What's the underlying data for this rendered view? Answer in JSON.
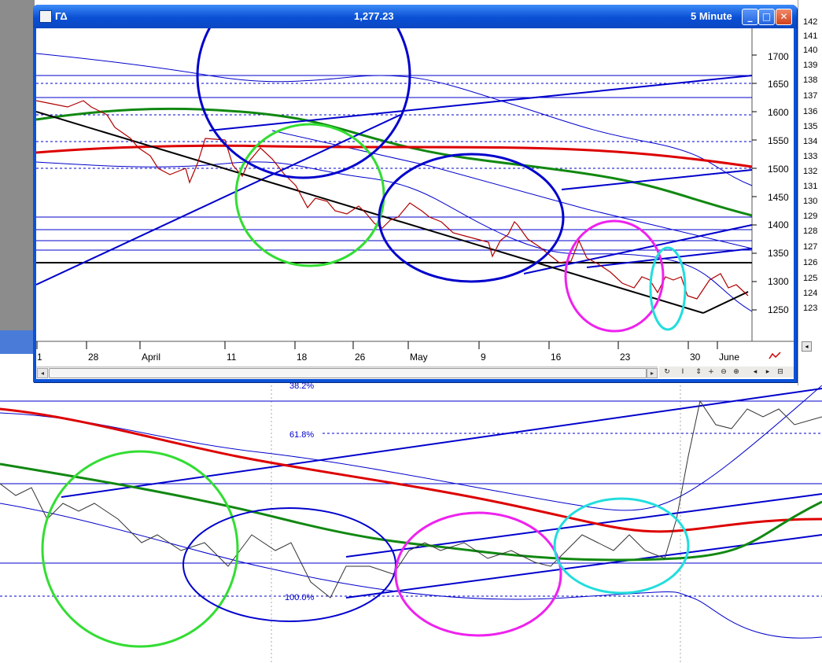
{
  "window": {
    "symbol": "ΓΔ",
    "price": "1,277.23",
    "interval": "5 Minute",
    "min_glyph": "_",
    "max_glyph": "□",
    "close_glyph": "✕"
  },
  "y_axis": [
    "1700",
    "1650",
    "1600",
    "1550",
    "1500",
    "1450",
    "1400",
    "1350",
    "1300",
    "1250"
  ],
  "x_axis": [
    "1",
    "28",
    "April",
    "11",
    "18",
    "26",
    "May",
    "9",
    "16",
    "23",
    "30",
    "June"
  ],
  "right_panel": [
    "142",
    "141",
    "140",
    "139",
    "138",
    "137",
    "136",
    "135",
    "134",
    "133",
    "132",
    "131",
    "130",
    "129",
    "128",
    "127",
    "126",
    "125",
    "124",
    "123"
  ],
  "lower_chart": {
    "fib_top": "38.2%",
    "fib_mid": "61.8%",
    "fib_low": "100.0%"
  },
  "toolbar": [
    "↻",
    "I",
    "⇕",
    "+",
    "⊖",
    "⊕",
    "◂",
    "▸",
    "⊟"
  ],
  "scroll": {
    "left": "◂",
    "right": "▸"
  },
  "colors": {
    "title": "#0b52d8",
    "trend": "#0000cc",
    "ma_red": "#dd0000",
    "ma_green": "#118811",
    "circle_green": "#33dd33",
    "circle_magenta": "#ee22ee",
    "circle_cyan": "#22dddd"
  }
}
